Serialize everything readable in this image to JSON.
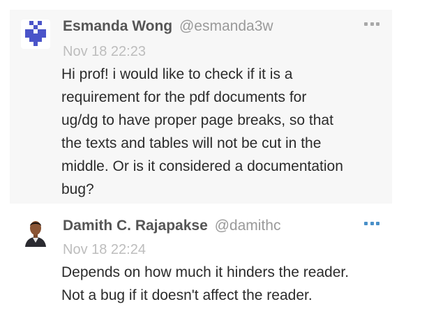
{
  "colors": {
    "accent": "#4a90c8",
    "identicon": "#4a54c9"
  },
  "messages": [
    {
      "display_name": "Esmanda Wong",
      "username": "@esmanda3w",
      "timestamp": "Nov 18 22:23",
      "text_lines": [
        "Hi prof! i would like to check if it is a",
        "requirement for the pdf documents for",
        "ug/dg to have proper page breaks, so that",
        "the texts and tables will not be cut in the",
        "middle. Or is it considered a documentation",
        "bug?"
      ],
      "avatar_icon": "identicon-avatar",
      "menu_icon": "more-options-icon"
    },
    {
      "display_name": "Damith C. Rajapakse",
      "username": "@damithc",
      "timestamp": "Nov 18 22:24",
      "text_lines": [
        "Depends on how much it hinders the reader.",
        "Not a bug if it doesn't affect the reader."
      ],
      "avatar_icon": "user-photo-avatar",
      "menu_icon": "more-options-icon"
    }
  ]
}
